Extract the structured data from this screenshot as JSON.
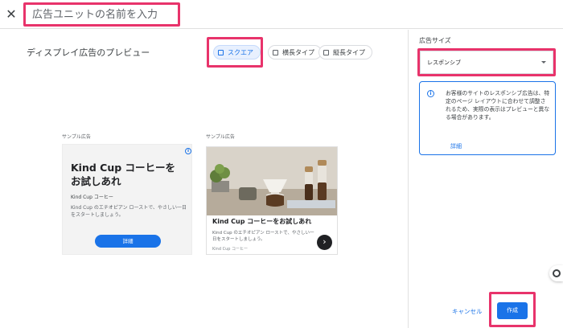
{
  "header": {
    "close_glyph": "✕",
    "name_placeholder": "広告ユニットの名前を入力"
  },
  "preview": {
    "title": "ディスプレイ広告のプレビュー",
    "tabs": [
      {
        "label": "スクエア",
        "selected": true
      },
      {
        "label": "横長タイプ",
        "selected": false
      },
      {
        "label": "縦長タイプ",
        "selected": false
      }
    ],
    "sample_label": "サンプル広告",
    "card1": {
      "title": "Kind Cup コーヒーをお試しあれ",
      "advertiser": "Kind Cup コーヒー",
      "description": "Kind Cup のエチオピアン ローストで、やさしい一日をスタートしましょう。",
      "button_label": "詳細"
    },
    "card2": {
      "title": "Kind Cup コーヒーをお試しあれ",
      "description": "Kind Cup のエチオピアン ローストで、やさしい一日をスタートしましょう。",
      "advertiser": "Kind Cup コーヒー",
      "next_glyph": "›"
    }
  },
  "sidebar": {
    "size_label": "広告サイズ",
    "size_value": "レスポンシブ",
    "info_text": "お客様のサイトのレスポンシブ広告は、特定のページ レイアウトに合わせて調整されるため、実際の表示はプレビューと異なる場合があります。",
    "info_link": "詳細",
    "cancel_label": "キャンセル",
    "create_label": "作成"
  },
  "colors": {
    "accent": "#1a73e8",
    "highlight": "#e8336b"
  }
}
